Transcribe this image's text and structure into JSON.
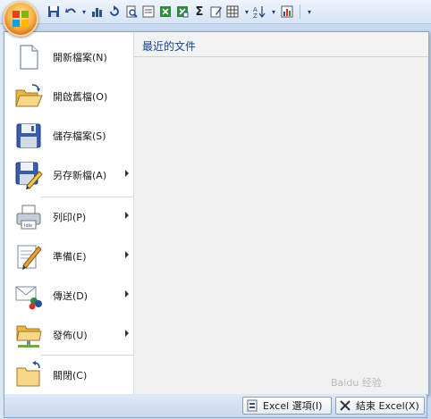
{
  "quick_access_toolbar": {
    "icons": [
      "save-icon",
      "undo-icon",
      "undo-dropdown-icon",
      "chart-icon",
      "redo-icon",
      "print-preview-icon",
      "form-icon",
      "excel-icon-1",
      "excel-icon-2",
      "sum-icon",
      "edit-icon",
      "table-icon",
      "sort-icon",
      "chart-wizard-icon",
      "customize-icon"
    ],
    "sum_glyph": "Σ"
  },
  "menu": {
    "items": [
      {
        "label": "開新檔案(N)",
        "icon": "new-document-icon",
        "has_submenu": false
      },
      {
        "label": "開啟舊檔(O)",
        "icon": "open-folder-icon",
        "has_submenu": false
      },
      {
        "label": "儲存檔案(S)",
        "icon": "save-disk-icon",
        "has_submenu": false
      },
      {
        "label": "另存新檔(A)",
        "icon": "save-as-icon",
        "has_submenu": true
      },
      {
        "label": "列印(P)",
        "icon": "printer-icon",
        "has_submenu": true
      },
      {
        "label": "準備(E)",
        "icon": "prepare-icon",
        "has_submenu": true
      },
      {
        "label": "傳送(D)",
        "icon": "send-icon",
        "has_submenu": true
      },
      {
        "label": "發佈(U)",
        "icon": "publish-icon",
        "has_submenu": true
      },
      {
        "label": "關閉(C)",
        "icon": "close-folder-icon",
        "has_submenu": false
      }
    ],
    "recent_title": "最近的文件"
  },
  "bottom": {
    "options_label": "Excel 選項(I)",
    "exit_label": "結束 Excel(X)"
  },
  "watermark": "Baidu 经验"
}
